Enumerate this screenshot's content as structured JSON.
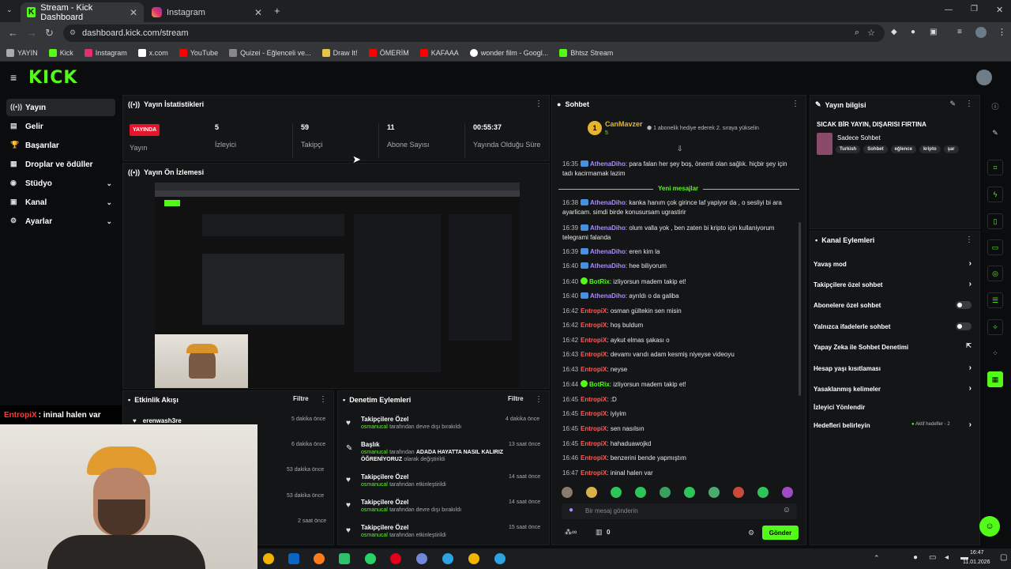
{
  "browser": {
    "tabs": [
      {
        "label": "Stream - Kick Dashboard"
      },
      {
        "label": "Instagram"
      }
    ],
    "url": "dashboard.kick.com/stream",
    "bookmarks": [
      "YAYIN",
      "Kick",
      "Instagram",
      "x.com",
      "YouTube",
      "Quizei - Eğlenceli ve...",
      "Draw It!",
      "ÖMERİM",
      "KAFAAA",
      "wonder film - Googl...",
      "Bhtsz Stream"
    ]
  },
  "logo": "KICK",
  "sidebar": {
    "items": [
      {
        "label": "Yayın"
      },
      {
        "label": "Gelir"
      },
      {
        "label": "Başarılar"
      },
      {
        "label": "Droplar ve ödüller"
      },
      {
        "label": "Stüdyo"
      },
      {
        "label": "Kanal"
      },
      {
        "label": "Ayarlar"
      }
    ]
  },
  "stats": {
    "title": "Yayın İstatistikleri",
    "live_badge": "YAYINDA",
    "items": [
      {
        "value": "",
        "label": "Yayın"
      },
      {
        "value": "5",
        "label": "İzleyici"
      },
      {
        "value": "59",
        "label": "Takipçi"
      },
      {
        "value": "11",
        "label": "Abone Sayısı"
      },
      {
        "value": "00:55:37",
        "label": "Yayında Olduğu Süre"
      }
    ]
  },
  "preview": {
    "title": "Yayın Ön İzlemesi"
  },
  "activity": {
    "title": "Etkinlik Akışı",
    "filter": "Filtre",
    "items": [
      {
        "name": "erenwash3re",
        "time": "5 dakika önce"
      },
      {
        "name": "",
        "time": "6 dakika önce"
      },
      {
        "name": "",
        "time": "53 dakika önce"
      },
      {
        "name": "",
        "time": "53 dakika önce"
      },
      {
        "name": "",
        "time": "2 saat önce"
      }
    ]
  },
  "overlay": {
    "user": "EntropiX",
    "text": ": ininal halen var"
  },
  "moderation": {
    "title": "Denetim Eylemleri",
    "filter": "Filtre",
    "items": [
      {
        "title": "Takipçilere Özel",
        "user": "osmanucal",
        "desc": "tarafından devre dışı bırakıldı",
        "extra": "",
        "time": "4 dakika önce"
      },
      {
        "title": "Başlık",
        "user": "osmanucal",
        "desc": "tarafından",
        "extra": "ADADA HAYATTA NASIL KALIRIZ ÖĞRENİYORUZ",
        "extra2": "olarak değiştirildi",
        "time": "13 saat önce"
      },
      {
        "title": "Takipçilere Özel",
        "user": "osmanucal",
        "desc": "tarafından etkinleştirildi",
        "extra": "",
        "time": "14 saat önce"
      },
      {
        "title": "Takipçilere Özel",
        "user": "osmanucal",
        "desc": "tarafından devre dışı bırakıldı",
        "extra": "",
        "time": "14 saat önce"
      },
      {
        "title": "Takipçilere Özel",
        "user": "osmanucal",
        "desc": "tarafından etkinleştirildi",
        "extra": "",
        "time": "15 saat önce"
      }
    ]
  },
  "chat": {
    "title": "Sohbet",
    "pinned_user": "CanMavzer",
    "pinned_count": "5",
    "pinned_note": "1 abonelik hediye ederek 2. sıraya yükselin",
    "new_messages": "Yeni mesajlar",
    "messages": [
      {
        "time": "16:35",
        "user": "AthenaDiho",
        "cls": "uA",
        "text": "para falan her şey boş, önemli olan sağlık. hiçbir şey için tadı kacirmamak lazim"
      },
      {
        "time": "16:38",
        "user": "AthenaDiho",
        "cls": "uA",
        "text": "kanka hanım çok girince laf yapiyor da , o sesliyi bi ara ayarlicam. simdi birde konusursam ugrastirir"
      },
      {
        "time": "16:39",
        "user": "AthenaDiho",
        "cls": "uA",
        "text": "olum valla yok , ben zaten bi kripto için kullaniyorum telegrami falanda"
      },
      {
        "time": "16:39",
        "user": "AthenaDiho",
        "cls": "uA",
        "text": "eren kim la"
      },
      {
        "time": "16:40",
        "user": "AthenaDiho",
        "cls": "uA",
        "text": "hee biliyorum"
      },
      {
        "time": "16:40",
        "user": "BotRix",
        "cls": "uB",
        "text": "izliyorsun madem takip et!"
      },
      {
        "time": "16:40",
        "user": "AthenaDiho",
        "cls": "uA",
        "text": "ayrıldı o da galiba"
      },
      {
        "time": "16:42",
        "user": "EntropiX",
        "cls": "uE",
        "text": "osman gültekin sen misin"
      },
      {
        "time": "16:42",
        "user": "EntropiX",
        "cls": "uE",
        "text": "hoş buldum"
      },
      {
        "time": "16:42",
        "user": "EntropiX",
        "cls": "uE",
        "text": "aykut elmas şakası o"
      },
      {
        "time": "16:43",
        "user": "EntropiX",
        "cls": "uE",
        "text": "devamı varıdı adam kesmiş niyeyse videoyu"
      },
      {
        "time": "16:43",
        "user": "EntropiX",
        "cls": "uE",
        "text": "neyse"
      },
      {
        "time": "16:44",
        "user": "BotRix",
        "cls": "uB",
        "text": "izliyorsun madem takip et!"
      },
      {
        "time": "16:45",
        "user": "EntropiX",
        "cls": "uE",
        "text": ":D"
      },
      {
        "time": "16:45",
        "user": "EntropiX",
        "cls": "uE",
        "text": "iyiyim"
      },
      {
        "time": "16:45",
        "user": "EntropiX",
        "cls": "uE",
        "text": "sen nasılsın"
      },
      {
        "time": "16:45",
        "user": "EntropiX",
        "cls": "uE",
        "text": "hahaduawojkd"
      },
      {
        "time": "16:46",
        "user": "EntropiX",
        "cls": "uE",
        "text": "benzerini bende yapmıştım"
      },
      {
        "time": "16:47",
        "user": "EntropiX",
        "cls": "uE",
        "text": "ininal halen var"
      }
    ],
    "input_placeholder": "Bir mesaj gönderin",
    "count": "0",
    "send": "Gönder"
  },
  "streaminfo": {
    "title": "Yayın bilgisi",
    "stream_title": "SICAK BİR YAYIN, DIŞARISI FIRTINA",
    "category": "Sadece Sohbet",
    "tags": [
      "Turkish",
      "Sohbet",
      "eğlence",
      "kripto",
      "şar"
    ]
  },
  "channel_actions": {
    "title": "Kanal Eylemleri",
    "items": [
      {
        "label": "Yavaş mod",
        "kind": "chev"
      },
      {
        "label": "Takipçilere özel sohbet",
        "kind": "chev"
      },
      {
        "label": "Abonelere özel sohbet",
        "kind": "toggle"
      },
      {
        "label": "Yalnızca ifadelerle sohbet",
        "kind": "toggle"
      },
      {
        "label": "Yapay Zeka ile Sohbet Denetimi",
        "kind": "ext"
      },
      {
        "label": "Hesap yaşı kısıtlaması",
        "kind": "chev"
      },
      {
        "label": "Yasaklanmış kelimeler",
        "kind": "chev"
      },
      {
        "label": "İzleyici Yönlendir",
        "kind": "none"
      },
      {
        "label": "Hedefleri belirleyin",
        "kind": "chev"
      }
    ],
    "goals_status": "Aktif hedefler - 2"
  },
  "taskbar": {
    "time": "16:47",
    "date": "11.01.2026"
  },
  "colors": {
    "accent": "#53fc18",
    "live": "#e6152e",
    "bg": "#0b0c0e",
    "panel": "#141517"
  }
}
